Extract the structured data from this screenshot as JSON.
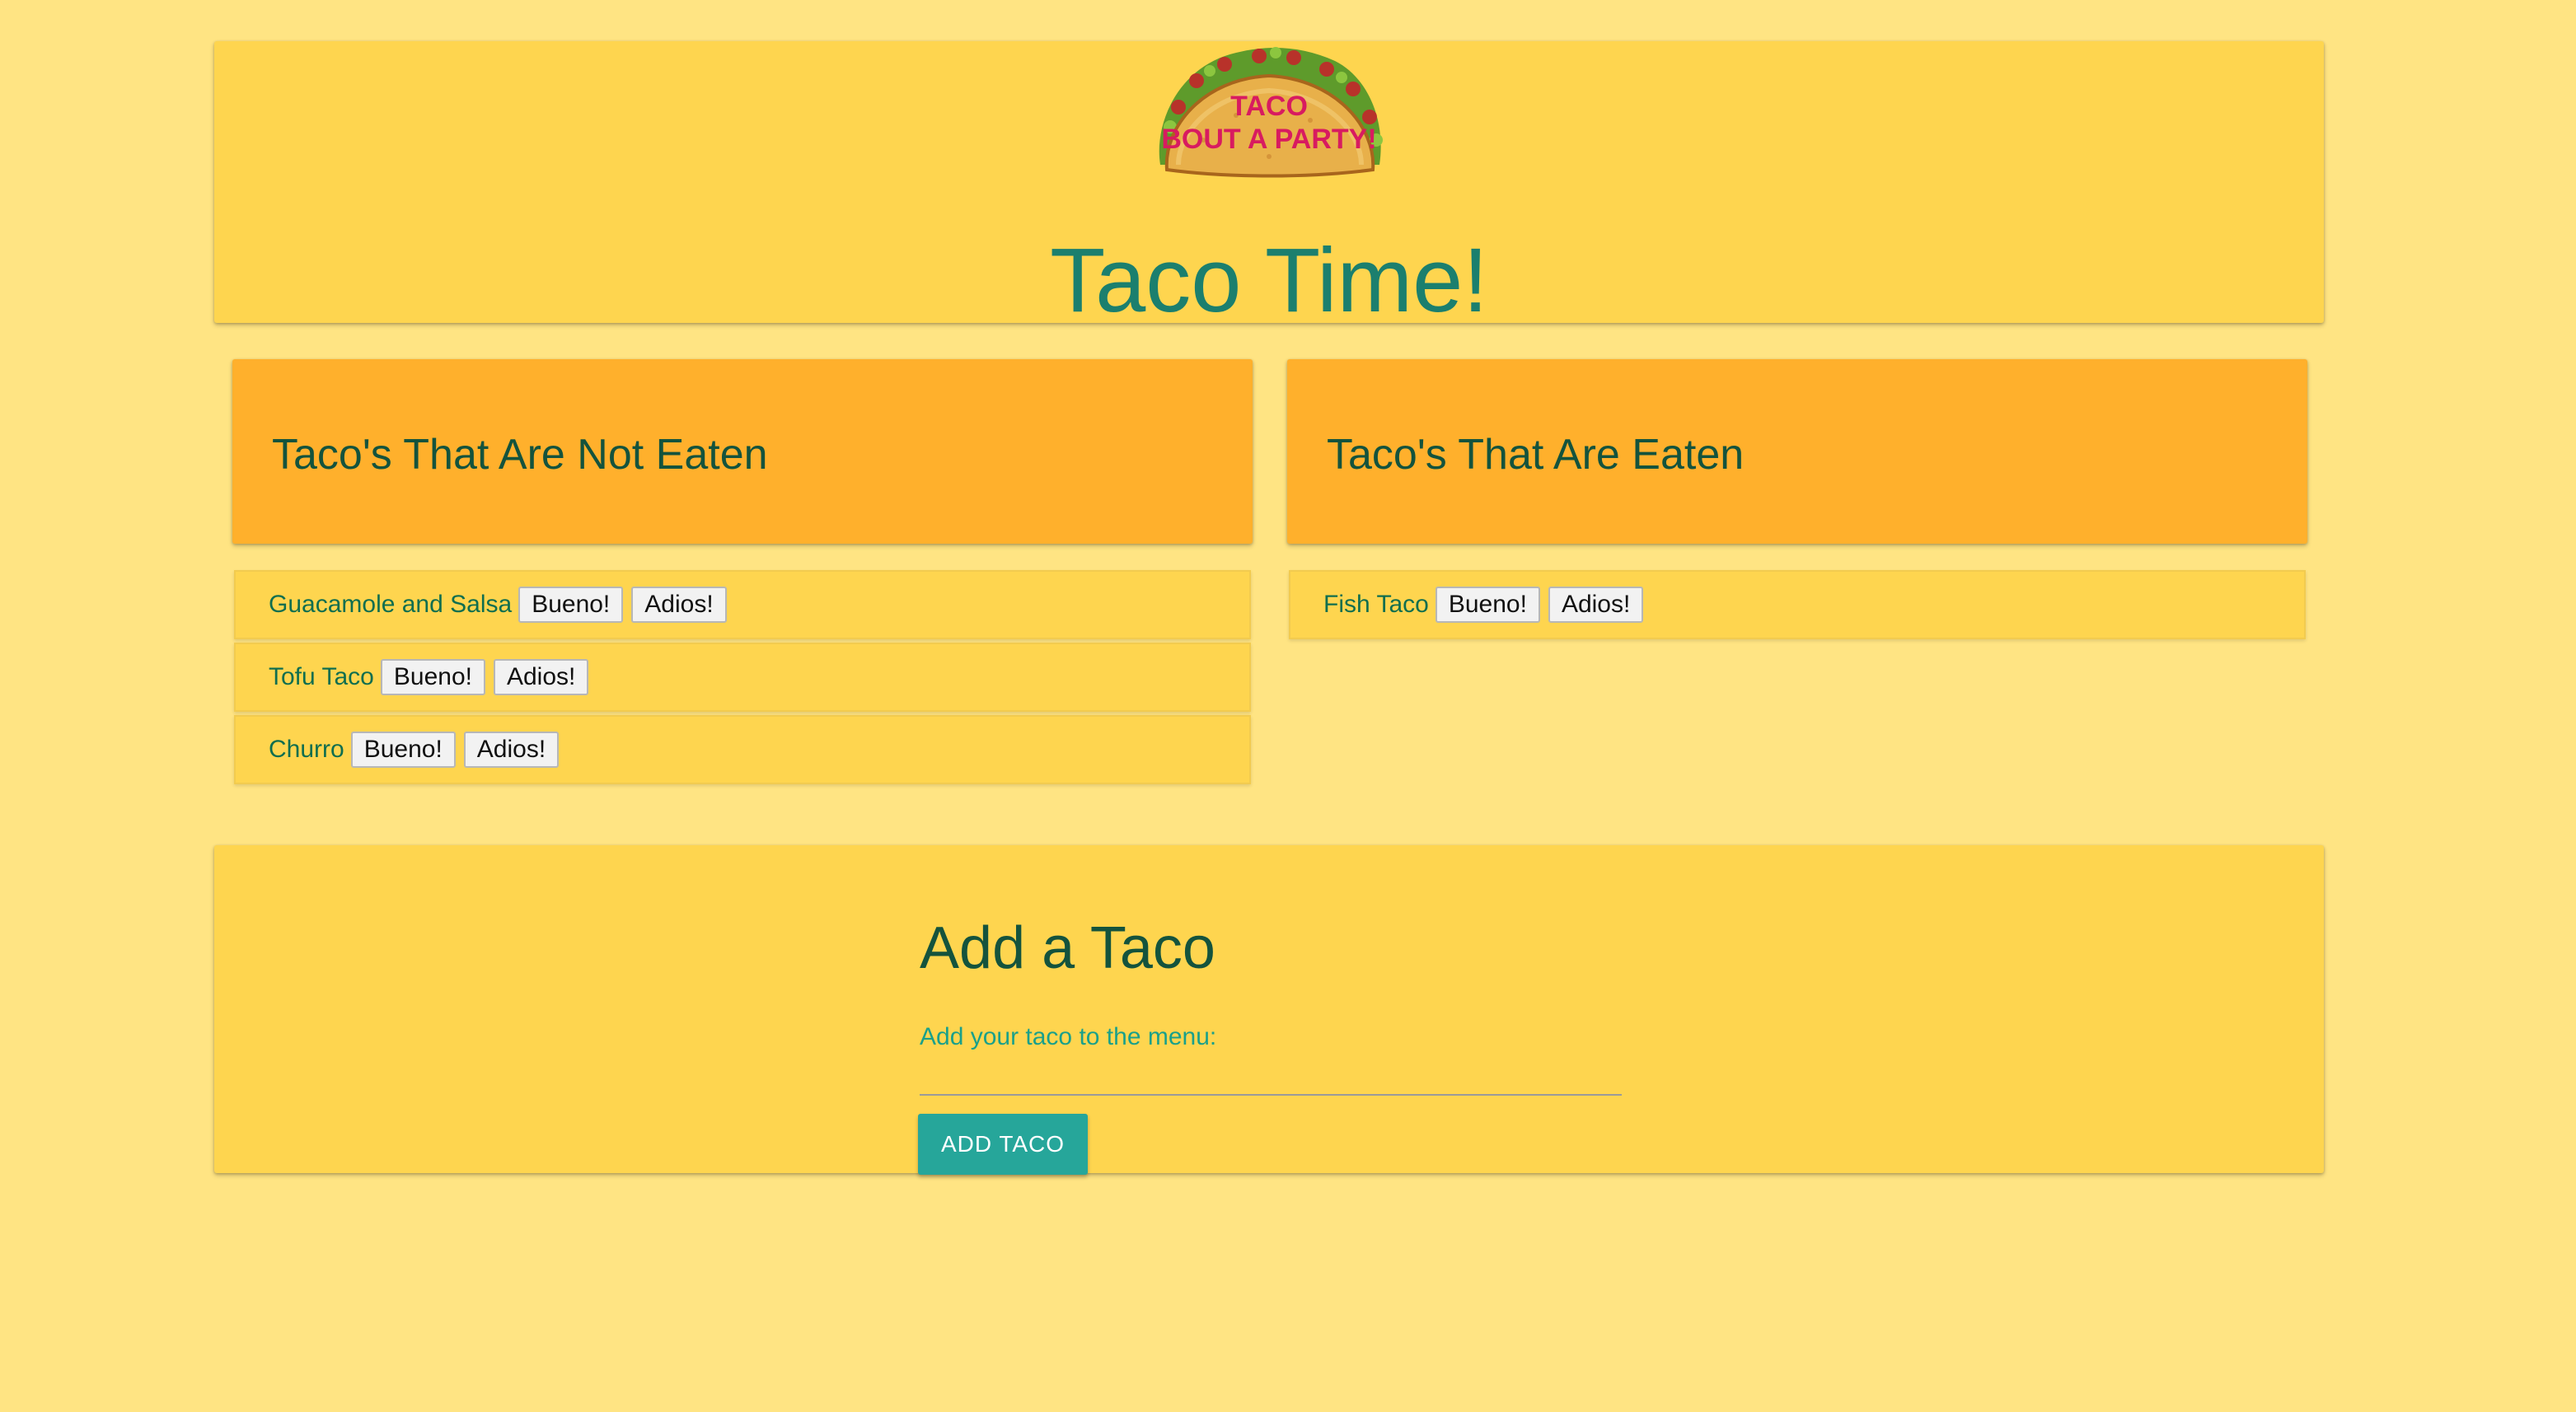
{
  "header": {
    "logo": {
      "icon": "taco-logo-icon",
      "text_line1": "TACO",
      "text_line2": "BOUT A PARTY!"
    },
    "title": "Taco Time!"
  },
  "columns": {
    "not_eaten": {
      "heading": "Taco's That Are Not Eaten",
      "items": [
        {
          "name": "Guacamole and Salsa",
          "bueno_label": "Bueno!",
          "adios_label": "Adios!"
        },
        {
          "name": "Tofu Taco",
          "bueno_label": "Bueno!",
          "adios_label": "Adios!"
        },
        {
          "name": "Churro",
          "bueno_label": "Bueno!",
          "adios_label": "Adios!"
        }
      ]
    },
    "eaten": {
      "heading": "Taco's That Are Eaten",
      "items": [
        {
          "name": "Fish Taco",
          "bueno_label": "Bueno!",
          "adios_label": "Adios!"
        }
      ]
    }
  },
  "add_form": {
    "title": "Add a Taco",
    "input_label": "Add your taco to the menu:",
    "input_value": "",
    "button_label": "ADD TACO"
  },
  "colors": {
    "background": "#ffe483",
    "card": "#fed54f",
    "column_header": "#ffb02c",
    "title_teal": "#1b7f6e",
    "button_teal": "#26a69a"
  }
}
